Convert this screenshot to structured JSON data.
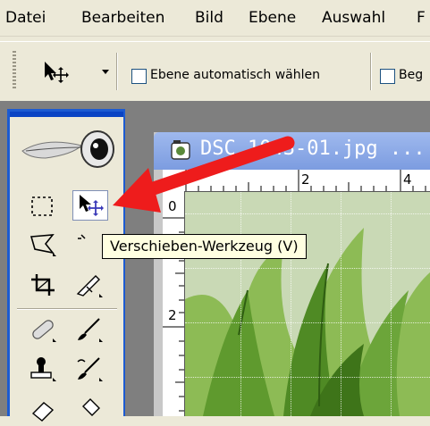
{
  "menubar": {
    "items": [
      "Datei",
      "Bearbeiten",
      "Bild",
      "Ebene",
      "Auswahl",
      "F"
    ]
  },
  "options": {
    "auto_select_label": "Ebene automatisch wählen",
    "second_label": "Beg"
  },
  "document": {
    "title": "DSC_1043-01.jpg ...",
    "ruler_top": [
      "0",
      "2",
      "4"
    ],
    "ruler_left": [
      "0",
      "2"
    ]
  },
  "tooltip": {
    "text": "Verschieben-Werkzeug (V)"
  },
  "colors": {
    "menubar_bg": "#ece9d8",
    "toolbox_border": "#1c5bd1",
    "doc_titlebar": "#8fb0ea",
    "tooltip_bg": "#ffffe1",
    "arrow": "#ee1c1c"
  }
}
